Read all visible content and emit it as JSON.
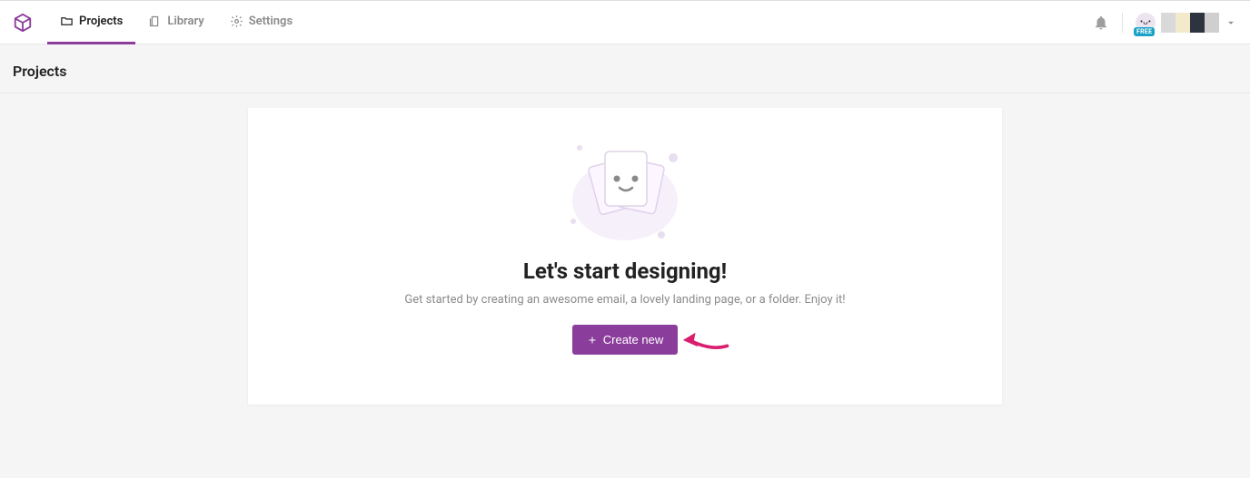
{
  "nav": {
    "projects": "Projects",
    "library": "Library",
    "settings": "Settings"
  },
  "user": {
    "plan_badge": "FREE"
  },
  "page": {
    "title": "Projects"
  },
  "empty_state": {
    "title": "Let's start designing!",
    "subtitle": "Get started by creating an awesome email, a lovely landing page, or a folder. Enjoy it!",
    "create_label": "Create new"
  },
  "colors": {
    "accent": "#8b3d9b",
    "arrow": "#d91e6d"
  }
}
